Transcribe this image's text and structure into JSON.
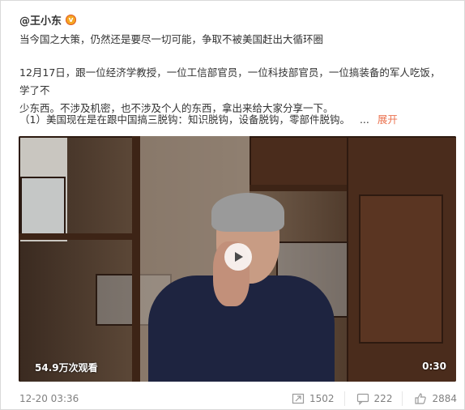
{
  "post": {
    "author": "@王小东",
    "verified_badge": "v",
    "headline": "当今国之大策，仍然还是要尽一切可能，争取不被美国赶出大循环圈",
    "paragraph_line1": "12月17日，跟一位经济学教授，一位工信部官员，一位科技部官员，一位搞装备的军人吃饭，学了不",
    "paragraph_line2": "少东西。不涉及机密，也不涉及个人的东西，拿出来给大家分享一下。",
    "item1": "（1）美国现在是在跟中国搞三脱钩：知识脱钩，设备脱钩，零部件脱钩。",
    "ellipsis": "...",
    "expand_label": "展开"
  },
  "video": {
    "views": "54.9万次观看",
    "duration": "0:30"
  },
  "footer": {
    "timestamp": "12-20 03:36",
    "reposts": "1502",
    "comments": "222",
    "likes": "2884"
  },
  "colors": {
    "accent": "#eb7350",
    "badge": "#f5a623"
  }
}
